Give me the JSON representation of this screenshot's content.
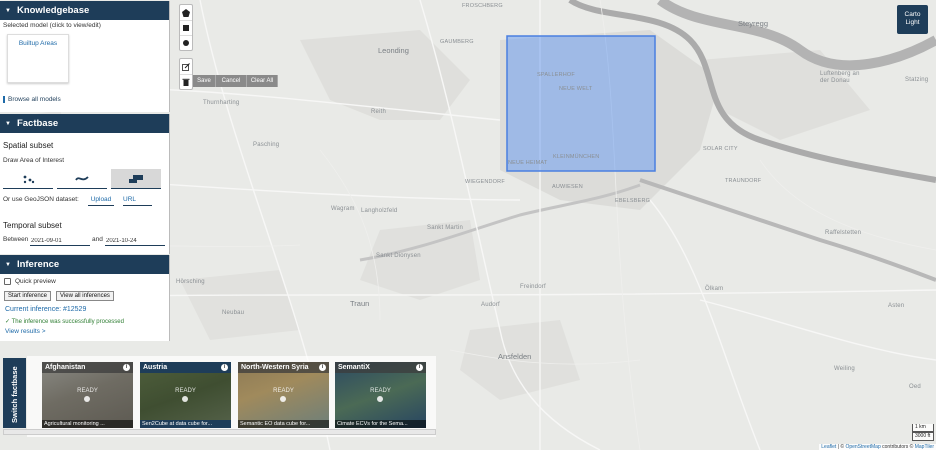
{
  "map": {
    "places": [
      "FROSCHBERG",
      "Steyregg",
      "Leonding",
      "GAUMBERG",
      "SPALLERHOF",
      "NEUE WELT",
      "Luftenberg an der Donau",
      "Statzing",
      "Thurnharting",
      "Reith",
      "Pasching",
      "NEUE HEIMAT",
      "KLEINMÜNCHEN",
      "SOLAR CITY",
      "TRAUNDORF",
      "WIEGENDORF",
      "AUWIESEN",
      "EBELSBERG",
      "Wagram",
      "Langholzfeld",
      "Sankt Martin",
      "Raffelstetten",
      "Sankt Dionysen",
      "Hörsching",
      "Traun",
      "Freindorf",
      "Ölkam",
      "Neubau",
      "Audorf",
      "Asten",
      "Ansfelden",
      "Weiling",
      "Oed"
    ]
  },
  "knowledgebase": {
    "title": "Knowledgebase",
    "selected_label": "Selected model (click to view/edit)",
    "model_name": "Builtup Areas",
    "browse_label": "Browse all models"
  },
  "factbase": {
    "title": "Factbase",
    "spatial_label": "Spatial subset",
    "draw_label": "Draw Area of Interest",
    "geojson_label": "Or use GeoJSON dataset:",
    "upload_label": "Upload",
    "url_label": "URL",
    "temporal_label": "Temporal subset",
    "between_label": "Between",
    "and_label": "and",
    "start_date": "2021-09-01",
    "end_date": "2021-10-24"
  },
  "inference": {
    "title": "Inference",
    "quick_preview_label": "Quick preview",
    "start_label": "Start inference",
    "view_all_label": "View all inferences",
    "current_label": "Current inference: #12529",
    "success_text": "The inference was successfully processed",
    "view_results_label": "View results >"
  },
  "draw_actions": {
    "save": "Save",
    "cancel": "Cancel",
    "clear_all": "Clear All"
  },
  "basemap_toggle": "Carto Light",
  "switch_factbase_label": "Switch factbase",
  "factbase_cards": [
    {
      "title": "Afghanistan",
      "status": "READY",
      "desc": "Agricultural monitoring ..."
    },
    {
      "title": "Austria",
      "status": "READY",
      "desc": "Sen2Cube at data cube for..."
    },
    {
      "title": "North-Western Syria",
      "status": "READY",
      "desc": "Semantic EO data cube for..."
    },
    {
      "title": "SemantiX",
      "status": "READY",
      "desc": "Cimate ECVs for the Sema..."
    }
  ],
  "scale": {
    "km": "1 km",
    "ft": "3000 ft"
  },
  "attribution": {
    "leaflet": "Leaflet",
    "sep": " | © ",
    "osm": "OpenStreetMap",
    "contrib": " contributors © ",
    "maptiler": "MapTiler"
  },
  "colors": {
    "header": "#1e3d59",
    "link": "#1e6aa8",
    "aoi_fill": "#6e9ef0",
    "aoi_stroke": "#4a7fe0",
    "river": "#ababab",
    "success": "#2e7d32"
  }
}
